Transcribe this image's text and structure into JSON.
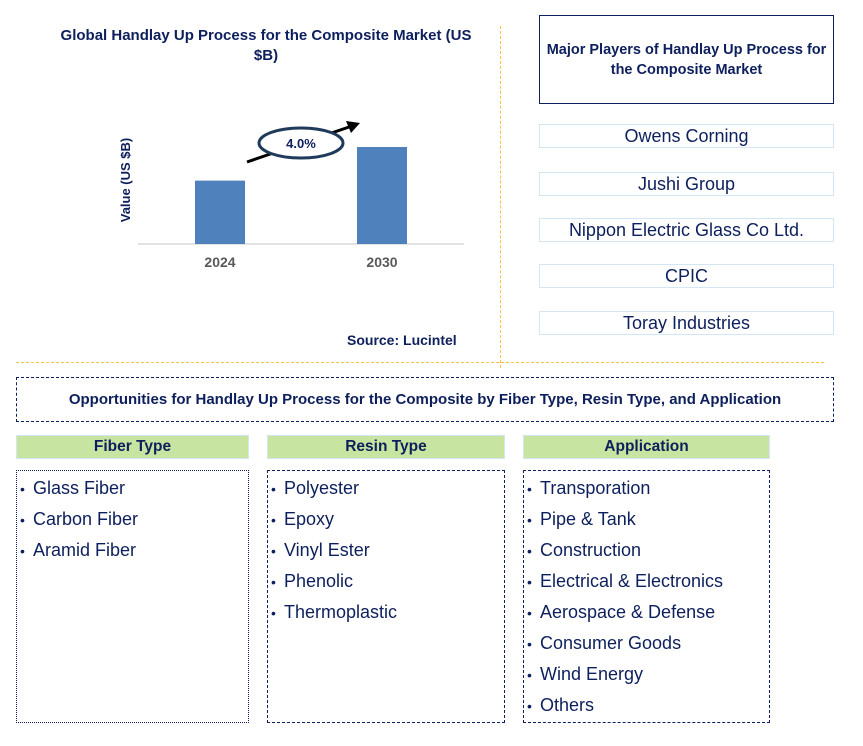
{
  "chart_data": {
    "type": "bar",
    "title": "Global Handlay Up Process for the Composite Market (US $B)",
    "categories": [
      "2024",
      "2030"
    ],
    "values": [
      1.0,
      1.53
    ],
    "value_note": "relative heights estimated; no values printed",
    "xlabel": "",
    "ylabel": "Value (US $B)",
    "annotation": {
      "label": "4.0%",
      "meaning": "CAGR 2024-2030"
    },
    "bar_color": "#4f81bd",
    "grid": false,
    "legend": "none"
  },
  "chart": {
    "title": "Global Handlay Up Process for the Composite Market (US $B)",
    "ylabel": "Value (US $B)",
    "cagr_label": "4.0%",
    "source": "Source: Lucintel"
  },
  "players": {
    "header": "Major Players of Handlay Up Process for the Composite Market",
    "items": [
      "Owens Corning",
      "Jushi Group",
      "Nippon Electric Glass Co Ltd.",
      "CPIC",
      "Toray Industries"
    ]
  },
  "opportunities": {
    "title": "Opportunities for Handlay Up Process for the Composite by Fiber Type, Resin Type, and Application",
    "categories": [
      {
        "header": "Fiber Type",
        "items": [
          "Glass Fiber",
          "Carbon Fiber",
          "Aramid Fiber"
        ]
      },
      {
        "header": "Resin Type",
        "items": [
          "Polyester",
          "Epoxy",
          "Vinyl Ester",
          "Phenolic",
          "Thermoplastic"
        ]
      },
      {
        "header": "Application",
        "items": [
          "Transporation",
          "Pipe & Tank",
          "Construction",
          "Electrical & Electronics",
          "Aerospace & Defense",
          "Consumer Goods",
          "Wind Energy",
          "Others"
        ]
      }
    ],
    "bullet": "•"
  },
  "colors": {
    "navy": "#0d1f5c",
    "bar": "#4f81bd",
    "header_green": "#c7e5a0",
    "separator_gold": "#f5c242",
    "player_border": "#d4e6f4"
  }
}
